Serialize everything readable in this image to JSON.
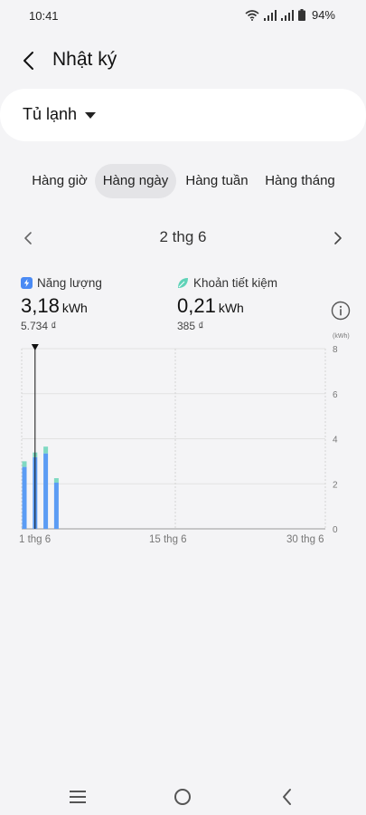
{
  "status_bar": {
    "time": "10:41",
    "battery": "94%",
    "icons": [
      "wifi-icon",
      "signal-icon",
      "signal-icon",
      "battery-icon"
    ]
  },
  "header": {
    "title": "Nhật ký",
    "back_icon": "back-arrow-icon"
  },
  "device": {
    "name": "Tủ lạnh",
    "caret_icon": "caret-down-icon"
  },
  "tabs": [
    {
      "label": "Hàng giờ",
      "active": false
    },
    {
      "label": "Hàng ngày",
      "active": true
    },
    {
      "label": "Hàng tuần",
      "active": false
    },
    {
      "label": "Hàng tháng",
      "active": false
    }
  ],
  "date_nav": {
    "label": "2 thg 6",
    "prev_icon": "chevron-left-icon",
    "next_icon": "chevron-right-icon"
  },
  "metrics": {
    "energy": {
      "label": "Năng lượng",
      "value": "3,18",
      "unit": "kWh",
      "cost": "5.734 ₫",
      "icon": "lightning-icon",
      "color": "#4a8af4"
    },
    "savings": {
      "label": "Khoản tiết kiệm",
      "value": "0,21",
      "unit": "kWh",
      "cost": "385 ₫",
      "icon": "leaf-icon",
      "color": "#5fd3b8"
    }
  },
  "info_icon": "info-icon",
  "chart_data": {
    "type": "bar",
    "stacked": true,
    "unit_label": "(kWh)",
    "x_tick_labels": [
      "1 thg 6",
      "15 thg 6",
      "30 thg 6"
    ],
    "x_tick_days": [
      1,
      15,
      30
    ],
    "y_ticks": [
      0,
      2,
      4,
      6,
      8
    ],
    "ylim": [
      0,
      8
    ],
    "days": [
      1,
      2,
      3,
      4
    ],
    "series": [
      {
        "name": "Năng lượng",
        "color": "#5b9cf4",
        "values": [
          2.75,
          3.18,
          3.35,
          2.05
        ]
      },
      {
        "name": "Khoản tiết kiệm",
        "color": "#7fd9c2",
        "values": [
          0.25,
          0.21,
          0.3,
          0.2
        ]
      }
    ],
    "selected_day": 2,
    "grid": true
  },
  "nav_bar": {
    "icons": [
      "recent-apps-icon",
      "home-icon",
      "back-icon"
    ]
  }
}
